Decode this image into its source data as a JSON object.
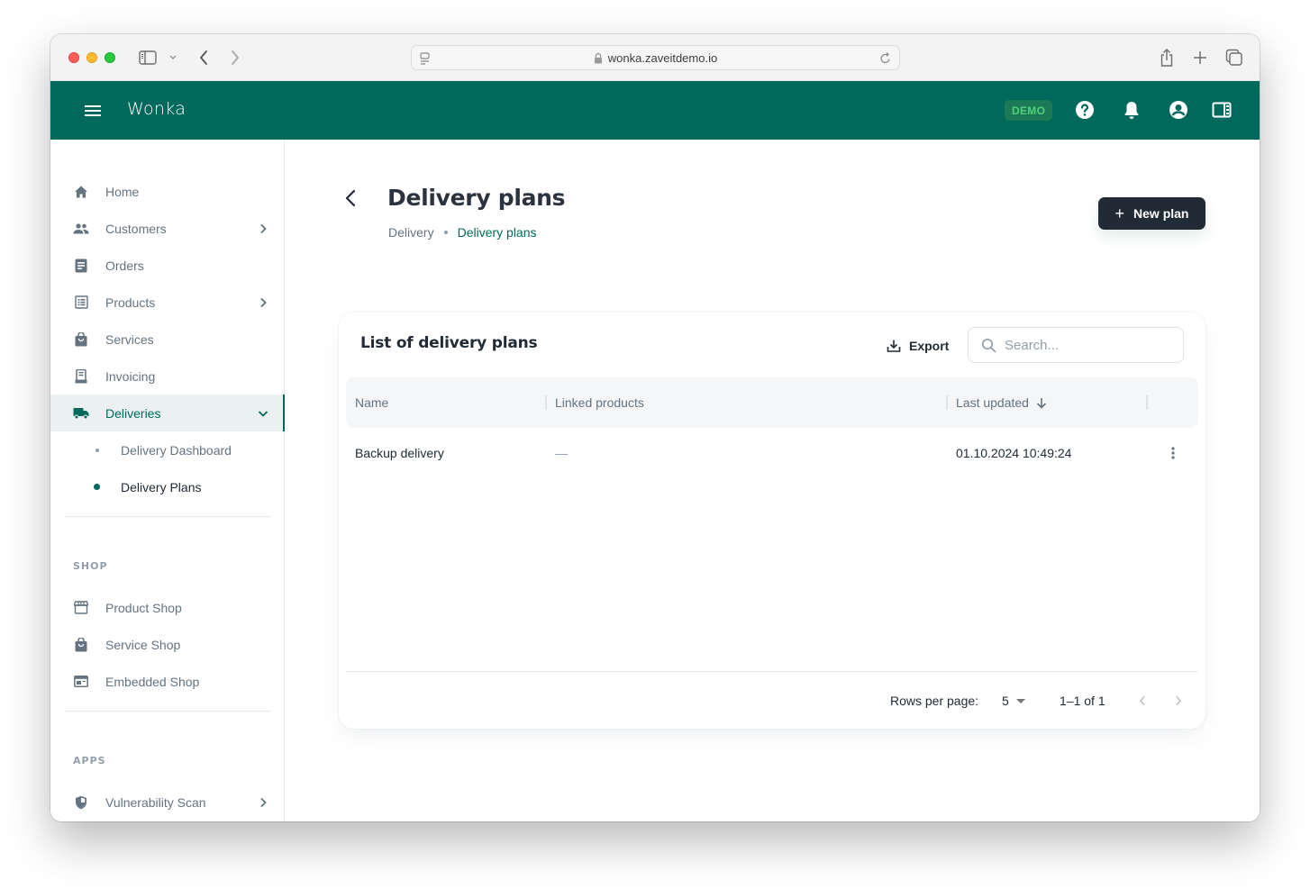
{
  "browser": {
    "url": "wonka.zaveitdemo.io"
  },
  "app": {
    "brand": "Wonka",
    "badge": "DEMO",
    "colors": {
      "primary": "#00695c",
      "dark_button": "#212b36",
      "badge_bg": "#1b7a55",
      "badge_text": "#4fd07a"
    }
  },
  "sidebar": {
    "items": [
      {
        "label": "Home",
        "icon": "home-icon"
      },
      {
        "label": "Customers",
        "icon": "people-icon",
        "has_chevron": true
      },
      {
        "label": "Orders",
        "icon": "document-icon"
      },
      {
        "label": "Products",
        "icon": "list-icon",
        "has_chevron": true
      },
      {
        "label": "Services",
        "icon": "shopping-bag-icon"
      },
      {
        "label": "Invoicing",
        "icon": "receipt-icon"
      },
      {
        "label": "Deliveries",
        "icon": "truck-icon",
        "has_chevron": true,
        "active": true,
        "expanded": true
      }
    ],
    "sub_items": [
      {
        "label": "Delivery Dashboard"
      },
      {
        "label": "Delivery Plans",
        "active": true
      }
    ],
    "shop_section": {
      "title": "SHOP",
      "items": [
        {
          "label": "Product Shop",
          "icon": "storefront-icon"
        },
        {
          "label": "Service Shop",
          "icon": "shopping-bag-icon"
        },
        {
          "label": "Embedded Shop",
          "icon": "embedded-window-icon"
        }
      ]
    },
    "apps_section": {
      "title": "APPS",
      "items": [
        {
          "label": "Vulnerability Scan",
          "icon": "shield-icon",
          "has_chevron": true
        }
      ]
    }
  },
  "page": {
    "title": "Delivery plans",
    "breadcrumb": [
      "Delivery",
      "Delivery plans"
    ],
    "new_button_label": "New plan"
  },
  "card": {
    "title": "List of delivery plans",
    "export_label": "Export",
    "search_placeholder": "Search...",
    "search_value": "",
    "columns": [
      "Name",
      "Linked products",
      "Last updated"
    ],
    "sort_column": "Last updated",
    "sort_direction": "desc",
    "rows": [
      {
        "name": "Backup delivery",
        "linked_products": "—",
        "last_updated": "01.10.2024 10:49:24"
      }
    ],
    "pagination": {
      "rows_per_page_label": "Rows per page:",
      "rows_per_page": "5",
      "range": "1–1 of 1"
    }
  }
}
